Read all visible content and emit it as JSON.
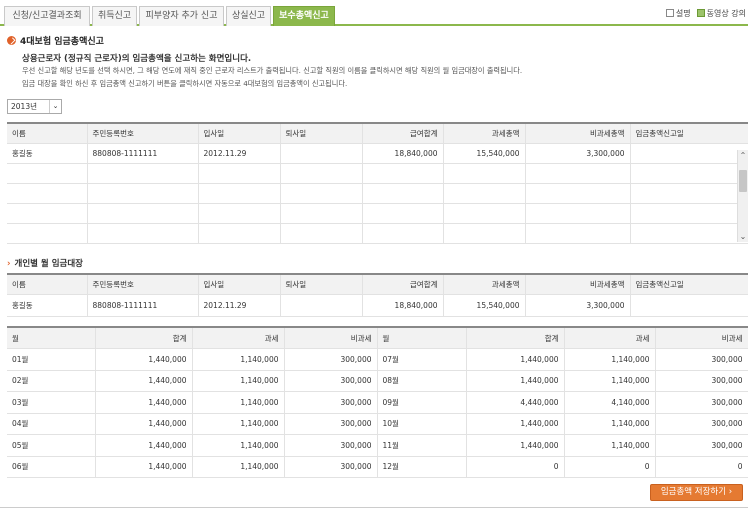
{
  "tabs": [
    {
      "label": "신청/신고결과조회",
      "active": false
    },
    {
      "label": "취득신고",
      "active": false
    },
    {
      "label": "피부양자 추가 신고",
      "active": false
    },
    {
      "label": "상실신고",
      "active": false
    },
    {
      "label": "보수총액신고",
      "active": true
    }
  ],
  "top_links": {
    "help": "설명",
    "video": "동영상 강의"
  },
  "section": {
    "title": "4대보험 임금총액신고",
    "desc_bold": "상용근로자 (정규직 근로자)의 임금총액을 신고하는 화면입니다.",
    "desc_lines": [
      "우선 신고할 해당 년도를 선택 하시면, 그 해당 연도에 재직 중인 근로자 리스트가 출력됩니다. 신고할 직원의 이름을 클릭하시면 해당 직원의 월 임금대장이 출력됩니다.",
      "임금 대장을 확인 하신 후 임금총액 신고하기 버튼을 클릭하시면 자동으로 4대보험의 임금총액이 신고됩니다."
    ]
  },
  "year_select": {
    "value": "2013년"
  },
  "employee_table": {
    "headers": [
      "이름",
      "주민등록번호",
      "입사일",
      "퇴사일",
      "급여합계",
      "과세총액",
      "비과세총액",
      "임금총액신고일"
    ],
    "rows": [
      [
        "홍길동",
        "880808-1111111",
        "2012.11.29",
        "",
        "18,840,000",
        "15,540,000",
        "3,300,000",
        ""
      ]
    ]
  },
  "ledger": {
    "title": "개인별 월 임금대장",
    "headers": [
      "이름",
      "주민등록번호",
      "입사일",
      "퇴사일",
      "급여합계",
      "과세총액",
      "비과세총액",
      "임금총액신고일"
    ],
    "row": [
      "홍길동",
      "880808-1111111",
      "2012.11.29",
      "",
      "18,840,000",
      "15,540,000",
      "3,300,000",
      ""
    ]
  },
  "monthly": {
    "headers": [
      "월",
      "합계",
      "과세",
      "비과세",
      "월",
      "합계",
      "과세",
      "비과세"
    ],
    "rows": [
      [
        "01월",
        "1,440,000",
        "1,140,000",
        "300,000",
        "07월",
        "1,440,000",
        "1,140,000",
        "300,000"
      ],
      [
        "02월",
        "1,440,000",
        "1,140,000",
        "300,000",
        "08월",
        "1,440,000",
        "1,140,000",
        "300,000"
      ],
      [
        "03월",
        "1,440,000",
        "1,140,000",
        "300,000",
        "09월",
        "4,440,000",
        "4,140,000",
        "300,000"
      ],
      [
        "04월",
        "1,440,000",
        "1,140,000",
        "300,000",
        "10월",
        "1,440,000",
        "1,140,000",
        "300,000"
      ],
      [
        "05월",
        "1,440,000",
        "1,140,000",
        "300,000",
        "11월",
        "1,440,000",
        "1,140,000",
        "300,000"
      ],
      [
        "06월",
        "1,440,000",
        "1,140,000",
        "300,000",
        "12월",
        "0",
        "0",
        "0"
      ]
    ]
  },
  "save_button": {
    "label": "임금총액 저장하기 ›"
  },
  "colors": {
    "accent_green": "#8cb84c",
    "accent_orange": "#e57a32"
  }
}
